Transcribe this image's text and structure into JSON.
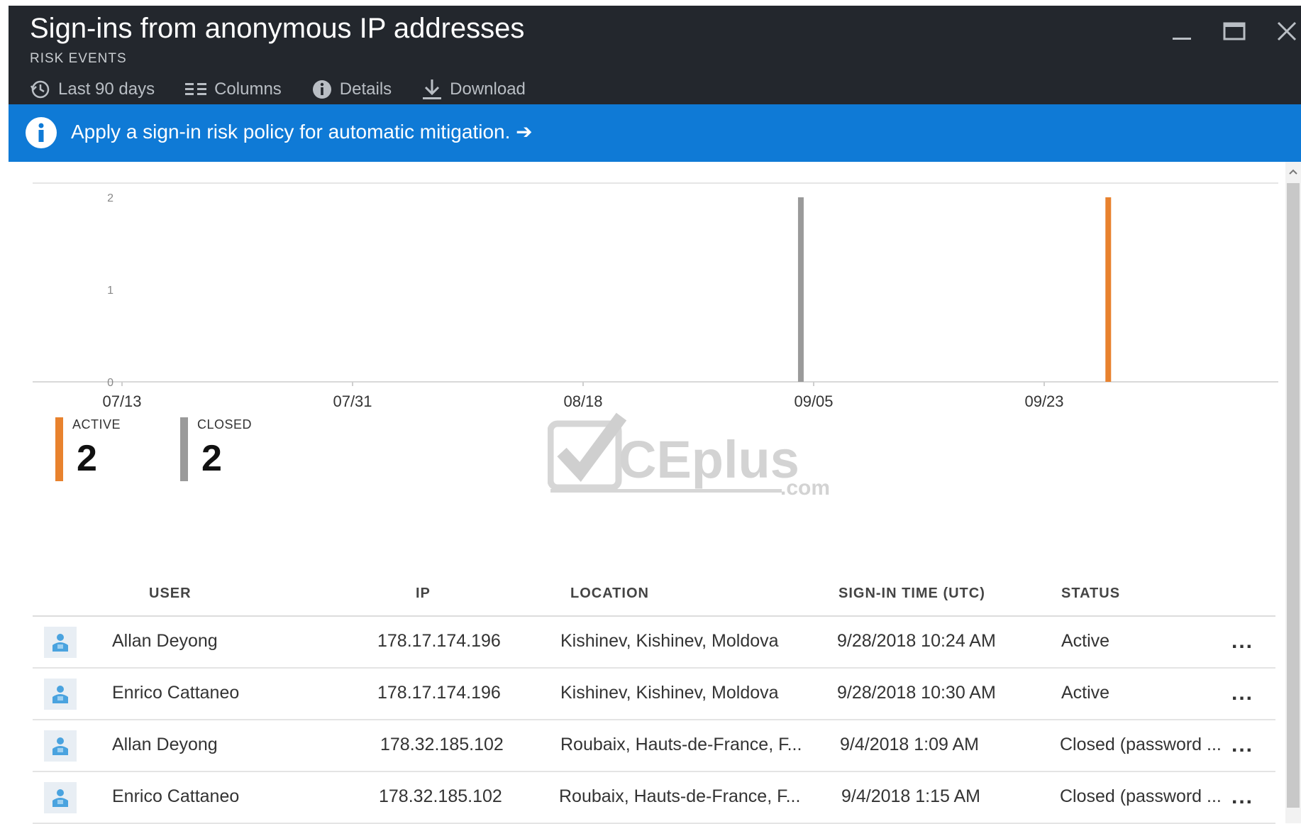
{
  "header": {
    "title": "Sign-ins from anonymous IP addresses",
    "subtitle": "RISK EVENTS",
    "toolbar": {
      "range_label": "Last 90 days",
      "columns_label": "Columns",
      "details_label": "Details",
      "download_label": "Download"
    }
  },
  "window_controls": [
    "minimize-icon",
    "maximize-icon",
    "close-icon"
  ],
  "infobar": {
    "text": "Apply a sign-in risk policy for automatic mitigation. ➔",
    "color": "#0f7ad6"
  },
  "colors": {
    "header_bg": "#23272d",
    "active": "#e8822e",
    "closed": "#9a9a9a"
  },
  "chart_data": {
    "type": "bar",
    "x_ticks": [
      "07/13",
      "07/31",
      "08/18",
      "09/05",
      "09/23"
    ],
    "y_ticks": [
      "0",
      "1",
      "2"
    ],
    "ylim": [
      0,
      2
    ],
    "series": [
      {
        "name": "CLOSED",
        "color": "#9a9a9a",
        "points": [
          {
            "x": "09/04",
            "y": 2
          }
        ]
      },
      {
        "name": "ACTIVE",
        "color": "#e8822e",
        "points": [
          {
            "x": "09/28",
            "y": 2
          }
        ]
      }
    ],
    "grid": false
  },
  "summary": [
    {
      "label": "ACTIVE",
      "value": "2",
      "color": "#e8822e"
    },
    {
      "label": "CLOSED",
      "value": "2",
      "color": "#9a9a9a"
    }
  ],
  "watermark": {
    "main": "CEplus",
    "suffix": ".com"
  },
  "table": {
    "columns": [
      "USER",
      "IP",
      "LOCATION",
      "SIGN-IN TIME (UTC)",
      "STATUS"
    ],
    "rows": [
      {
        "user": "Allan Deyong",
        "ip": "178.17.174.196",
        "location": "Kishinev, Kishinev, Moldova",
        "time": "9/28/2018 10:24 AM",
        "status": "Active",
        "more": "..."
      },
      {
        "user": "Enrico Cattaneo",
        "ip": "178.17.174.196",
        "location": "Kishinev, Kishinev, Moldova",
        "time": "9/28/2018 10:30 AM",
        "status": "Active",
        "more": "..."
      },
      {
        "user": "Allan Deyong",
        "ip": "178.32.185.102",
        "location": "Roubaix, Hauts-de-France, F...",
        "time": "9/4/2018 1:09 AM",
        "status": "Closed (password ...",
        "more": "..."
      },
      {
        "user": "Enrico Cattaneo",
        "ip": "178.32.185.102",
        "location": "Roubaix, Hauts-de-France, F...",
        "time": "9/4/2018 1:15 AM",
        "status": "Closed (password ...",
        "more": "..."
      }
    ]
  }
}
